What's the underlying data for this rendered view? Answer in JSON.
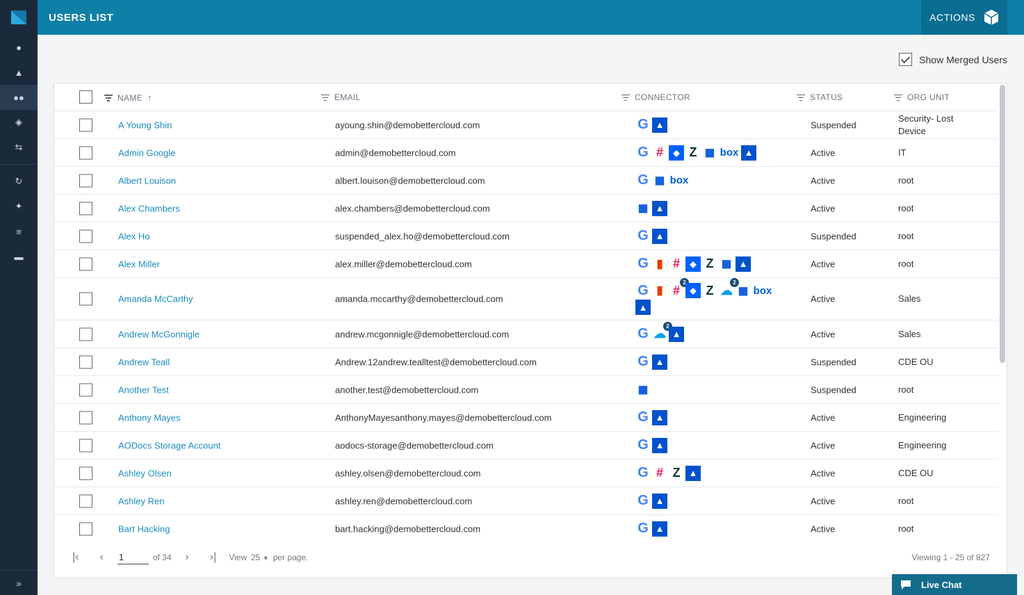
{
  "header": {
    "title": "USERS LIST",
    "actions_label": "ACTIONS"
  },
  "filters": {
    "show_merged_label": "Show Merged Users",
    "show_merged_checked": true
  },
  "table": {
    "columns": {
      "name": "NAME",
      "email": "EMAIL",
      "connector": "CONNECTOR",
      "status": "STATUS",
      "org_unit": "ORG UNIT"
    },
    "rows": [
      {
        "name": "A Young Shin",
        "email": "ayoung.shin@demobettercloud.com",
        "connectors": [
          "google",
          "atlassian"
        ],
        "status": "Suspended",
        "org": "Security- Lost Device"
      },
      {
        "name": "Admin Google",
        "email": "admin@demobettercloud.com",
        "connectors": [
          "google",
          "slack",
          "dropbox",
          "zendesk",
          "okta",
          "box",
          "atlassian"
        ],
        "status": "Active",
        "org": "IT"
      },
      {
        "name": "Albert Louison",
        "email": "albert.louison@demobettercloud.com",
        "connectors": [
          "google",
          "okta",
          "box"
        ],
        "status": "Active",
        "org": "root"
      },
      {
        "name": "Alex Chambers",
        "email": "alex.chambers@demobettercloud.com",
        "connectors": [
          "okta",
          "atlassian"
        ],
        "status": "Active",
        "org": "root"
      },
      {
        "name": "Alex Ho",
        "email": "suspended_alex.ho@demobettercloud.com",
        "connectors": [
          "google",
          "atlassian"
        ],
        "status": "Suspended",
        "org": "root"
      },
      {
        "name": "Alex Miller",
        "email": "alex.miller@demobettercloud.com",
        "connectors": [
          "google",
          "office",
          "slack",
          "dropbox",
          "zendesk",
          "okta",
          "atlassian"
        ],
        "status": "Active",
        "org": "root"
      },
      {
        "name": "Amanda McCarthy",
        "email": "amanda.mccarthy@demobettercloud.com",
        "connectors": [
          "google",
          "office",
          "slack2",
          "dropbox",
          "zendesk",
          "salesforce2",
          "okta",
          "box",
          "atlassian"
        ],
        "status": "Active",
        "org": "Sales"
      },
      {
        "name": "Andrew McGonnigle",
        "email": "andrew.mcgonnigle@demobettercloud.com",
        "connectors": [
          "google",
          "salesforce2",
          "atlassian"
        ],
        "status": "Active",
        "org": "Sales"
      },
      {
        "name": "Andrew Teall",
        "email": "Andrew.12andrew.tealltest@demobettercloud.com",
        "connectors": [
          "google",
          "atlassian"
        ],
        "status": "Suspended",
        "org": "CDE OU"
      },
      {
        "name": "Another Test",
        "email": "another.test@demobettercloud.com",
        "connectors": [
          "okta"
        ],
        "status": "Suspended",
        "org": "root"
      },
      {
        "name": "Anthony Mayes",
        "email": "AnthonyMayesanthony.mayes@demobettercloud.com",
        "connectors": [
          "google",
          "atlassian"
        ],
        "status": "Active",
        "org": "Engineering"
      },
      {
        "name": "AODocs Storage Account",
        "email": "aodocs-storage@demobettercloud.com",
        "connectors": [
          "google",
          "atlassian"
        ],
        "status": "Active",
        "org": "Engineering"
      },
      {
        "name": "Ashley Olsen",
        "email": "ashley.olsen@demobettercloud.com",
        "connectors": [
          "google",
          "slack",
          "zendesk",
          "atlassian"
        ],
        "status": "Active",
        "org": "CDE OU"
      },
      {
        "name": "Ashley Ren",
        "email": "ashley.ren@demobettercloud.com",
        "connectors": [
          "google",
          "atlassian"
        ],
        "status": "Active",
        "org": "root"
      },
      {
        "name": "Bart Hacking",
        "email": "bart.hacking@demobettercloud.com",
        "connectors": [
          "google",
          "atlassian"
        ],
        "status": "Active",
        "org": "root"
      }
    ]
  },
  "pager": {
    "page": "1",
    "of_label": "of 34",
    "view_label": "View",
    "per_page_value": "25",
    "per_page_label": "per page.",
    "viewing": "Viewing 1 - 25 of 827"
  },
  "live_chat": "Live Chat",
  "colors": {
    "header": "#0e7fa7",
    "sidebar": "#1b2a3a",
    "link": "#1b8cc0"
  }
}
